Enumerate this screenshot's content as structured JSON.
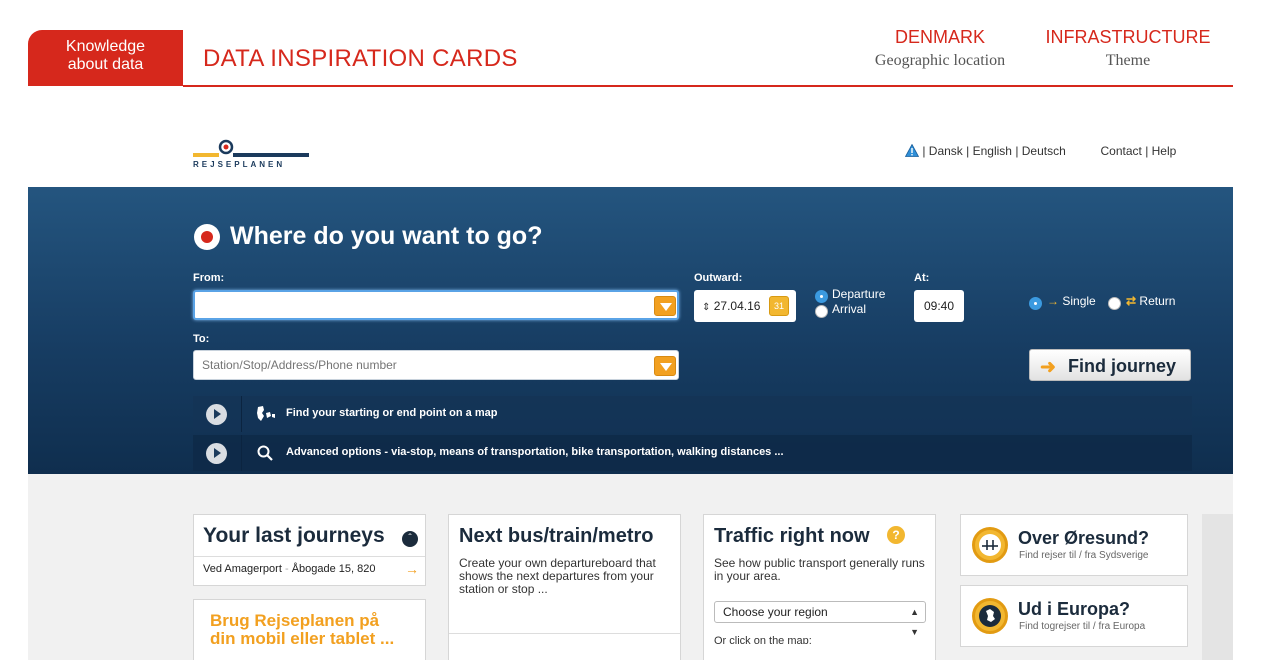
{
  "slide": {
    "badge_line1": "Knowledge",
    "badge_line2": "about data",
    "title": "DATA INSPIRATION CARDS",
    "tag1": {
      "value": "DENMARK",
      "caption": "Geographic location"
    },
    "tag2": {
      "value": "INFRASTRUCTURE",
      "caption": "Theme"
    },
    "accent_color": "#d6281c"
  },
  "site": {
    "logo_text": "REJSEPLANEN",
    "lang_sep": " | ",
    "lang_dansk": "Dansk",
    "lang_english": "English",
    "lang_deutsch": "Deutsch",
    "contact": "Contact",
    "help": "Help"
  },
  "search": {
    "heading": "Where do you want to go?",
    "from_label": "From:",
    "from_value": "",
    "to_label": "To:",
    "to_placeholder": "Station/Stop/Address/Phone number",
    "outward_label": "Outward:",
    "date": "27.04.16",
    "calendar_day": "31",
    "departure_label": "Departure",
    "arrival_label": "Arrival",
    "at_label": "At:",
    "time": "09:40",
    "single_label": "Single",
    "return_label": "Return",
    "find_button": "Find journey",
    "map_option": "Find your starting or end point on a map",
    "advanced_option": "Advanced options - via-stop, means of transportation, bike transportation, walking distances ..."
  },
  "cards": {
    "last_journeys": {
      "title": "Your last journeys",
      "item_from": "Ved Amagerport",
      "item_sep": "-",
      "item_to": "Åbogade 15, 820"
    },
    "mobile": {
      "line1": "Brug Rejseplanen på",
      "line2": "din mobil eller tablet ..."
    },
    "departures": {
      "title": "Next bus/train/metro",
      "text": "Create your own departureboard that shows the next departures from your station or stop ..."
    },
    "traffic": {
      "title": "Traffic right now",
      "text": "See how public transport generally runs in your area.",
      "select_value": "Choose your region",
      "map_text": "Or click on the map:"
    },
    "oresund": {
      "title": "Over Øresund?",
      "subtitle": "Find rejser til / fra Sydsverige"
    },
    "europe": {
      "title": "Ud i Europa?",
      "subtitle": "Find togrejser til / fra Europa"
    }
  },
  "colors": {
    "band_top": "#24557f",
    "band_bottom": "#0f2e4e",
    "orange": "#f2a020",
    "yellow": "#f2b730"
  },
  "icons": [
    "warning-icon",
    "calendar-icon",
    "play-icon",
    "denmark-map-icon",
    "search-icon",
    "arrow-right-icon",
    "chevron-up-icon",
    "help-icon",
    "bridge-icon",
    "europe-icon",
    "dropdown-icon"
  ]
}
